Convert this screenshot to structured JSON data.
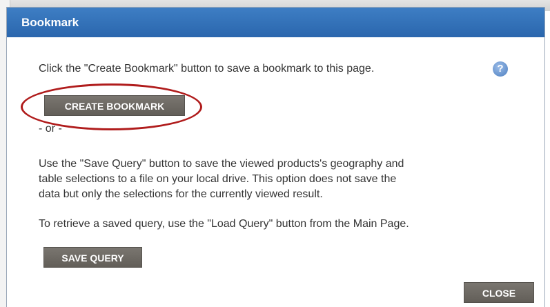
{
  "dialog": {
    "title": "Bookmark",
    "instruction": "Click the \"Create Bookmark\" button to save a bookmark to this page.",
    "help_icon": "help-icon",
    "create_bookmark_label": "CREATE BOOKMARK",
    "or_text": "- or -",
    "save_query_paragraph": [
      "Use the \"Save Query\" button to save the viewed products's geography and",
      "table selections to a file on your local drive. This option does not save the",
      "data but only the selections for the currently viewed result."
    ],
    "retrieve_text": "To retrieve a saved query, use the \"Load Query\" button from the Main Page.",
    "save_query_label": "SAVE QUERY",
    "close_label": "CLOSE"
  },
  "colors": {
    "titlebar": "#2f70b8",
    "button": "#6e6a64",
    "highlight_ellipse": "#b01c1c"
  }
}
